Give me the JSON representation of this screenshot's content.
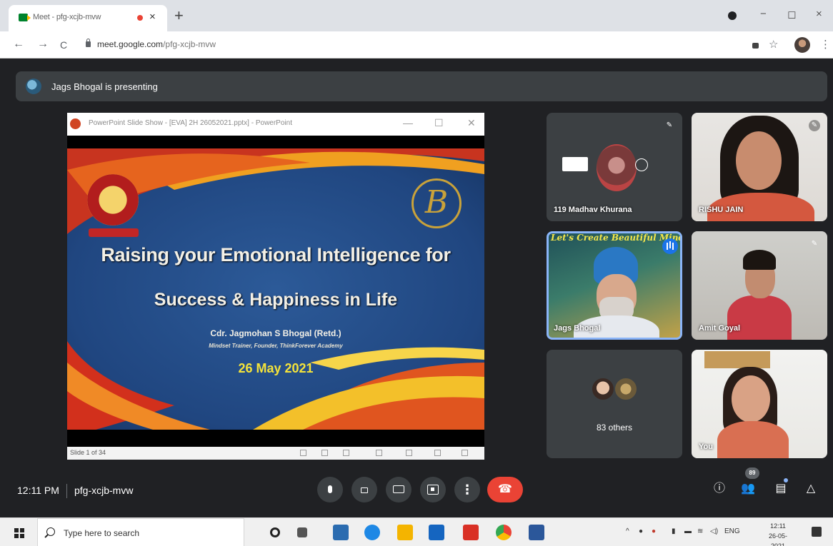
{
  "browser": {
    "tab_title": "Meet - pfg-xcjb-mvw",
    "tab_close": "×",
    "new_tab": "+",
    "url_host": "meet.google.com",
    "url_path": "/pfg-xcjb-mvw",
    "win_minimize": "−",
    "win_restore": "◻",
    "win_close": "×",
    "nav_back": "←",
    "nav_forward": "→",
    "nav_reload": "C",
    "bookmark": "☆",
    "menu": "⋮"
  },
  "meet": {
    "presenting_banner": "Jags Bhogal is presenting",
    "time": "12:11 PM",
    "meeting_code": "pfg-xcjb-mvw",
    "participant_count": "89",
    "mute_glyph": "🎤̸"
  },
  "slide_window": {
    "title": "PowerPoint Slide Show - [EVA] 2H 26052021.pptx] - PowerPoint",
    "status": "Slide 1 of 34",
    "controls": [
      "—",
      "☐",
      "✕"
    ]
  },
  "slide": {
    "title_line1": "Raising your Emotional Intelligence for",
    "title_line2": "Success & Happiness in Life",
    "presenter": "Cdr. Jagmohan S Bhogal (Retd.)",
    "role": "Mindset Trainer, Founder, ThinkForever Academy",
    "date": "26 May 2021",
    "logo_letter": "B"
  },
  "participants": [
    {
      "name": "119 Madhav Khurana"
    },
    {
      "name": "RISHU JAIN"
    },
    {
      "name": "Jags Bhogal",
      "banner": "Let's Create Beautiful Minds"
    },
    {
      "name": "Amit Goyal"
    },
    {
      "name": "83 others"
    },
    {
      "name": "You"
    }
  ],
  "taskbar": {
    "search_placeholder": "Type here to search",
    "lang": "ENG",
    "clock_time": "12:11",
    "clock_date": "26-05-2021",
    "tray_caret": "^"
  },
  "colors": {
    "meet_bg": "#202124",
    "tile_bg": "#3c4043",
    "end_call": "#ea4335",
    "speaking_blue": "#1a73e8",
    "slide_date_yellow": "#f4e33a"
  },
  "icons": {
    "mic": "microphone-icon",
    "camera": "camera-icon",
    "captions": "closed-captions-icon",
    "present": "present-screen-icon",
    "more": "more-vert-icon",
    "end": "call-end-icon",
    "info": "info-icon",
    "people": "people-icon",
    "chat": "chat-icon",
    "activities": "activities-icon"
  }
}
